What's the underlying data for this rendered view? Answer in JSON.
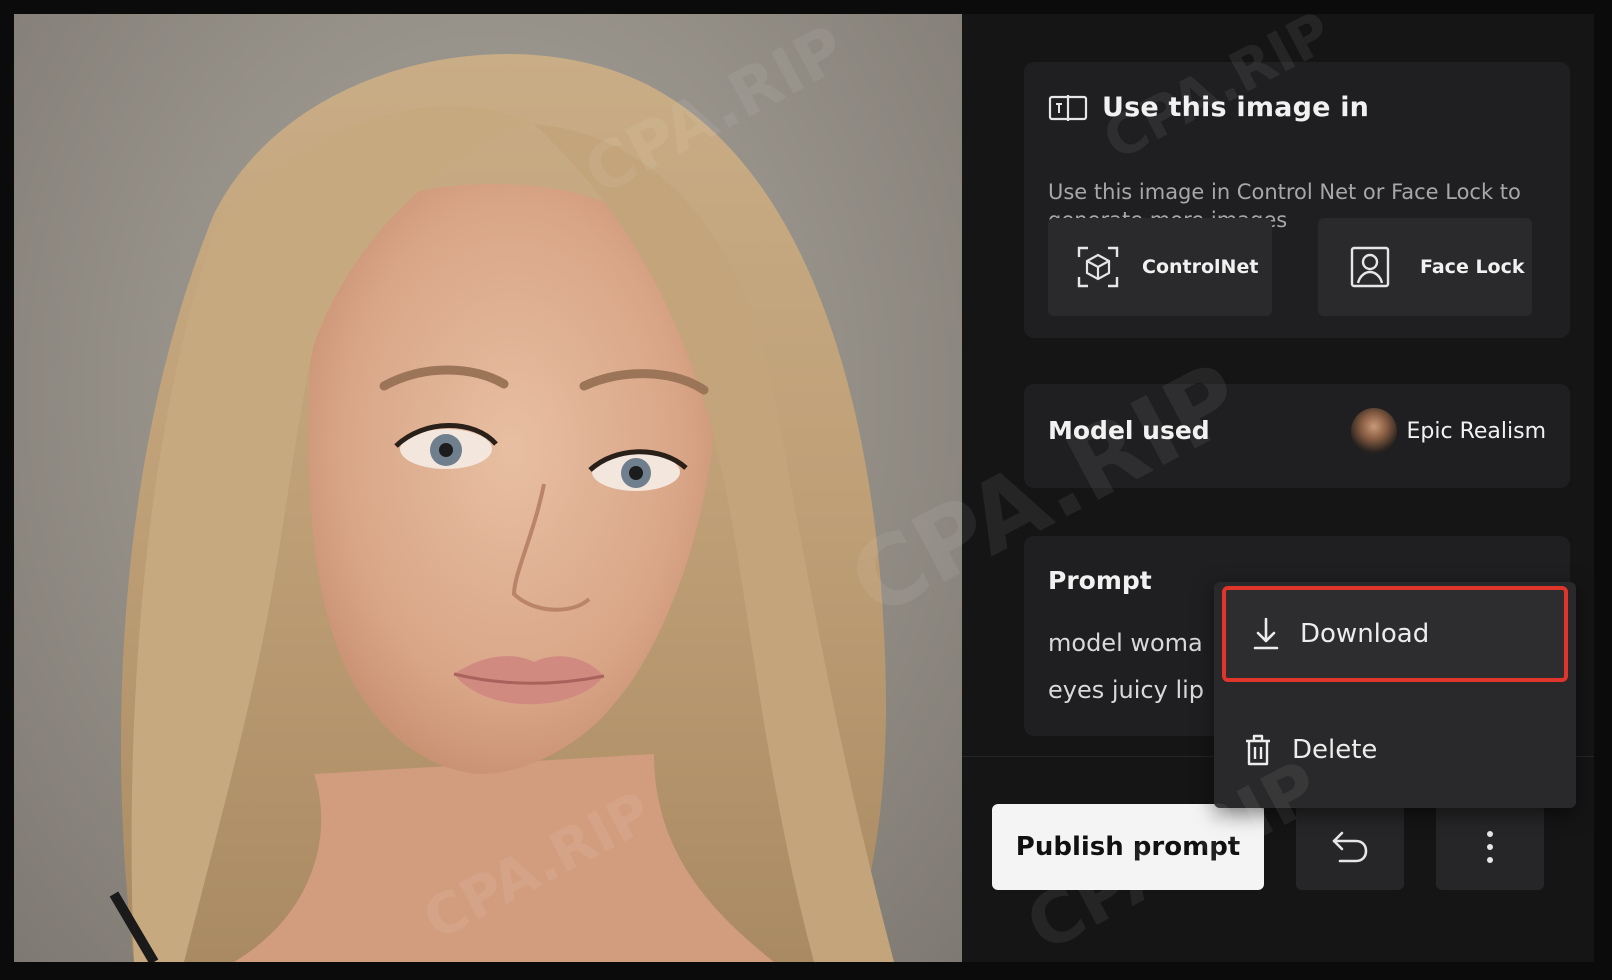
{
  "use_section": {
    "title": "Use this image in",
    "description": "Use this image in Control Net or Face Lock to generate more images",
    "controlnet_label": "ControlNet",
    "facelock_label": "Face Lock"
  },
  "model": {
    "label": "Model used",
    "name": "Epic Realism"
  },
  "prompt": {
    "label": "Prompt",
    "line1": "model woma",
    "line2": "eyes juicy lip"
  },
  "menu": {
    "download_label": "Download",
    "delete_label": "Delete"
  },
  "actions": {
    "publish_label": "Publish prompt"
  },
  "watermark": "CPA.RIP",
  "colors": {
    "highlight": "#e0352b",
    "publish_bg": "#f4f4f4",
    "panel_bg": "#151516",
    "card_bg": "#1f1f21"
  },
  "icons": {
    "use_image": "use-image-icon",
    "controlnet": "cube-scan-icon",
    "facelock": "portrait-icon",
    "download": "download-icon",
    "delete": "trash-icon",
    "undo": "undo-icon",
    "more": "more-vertical-icon"
  }
}
